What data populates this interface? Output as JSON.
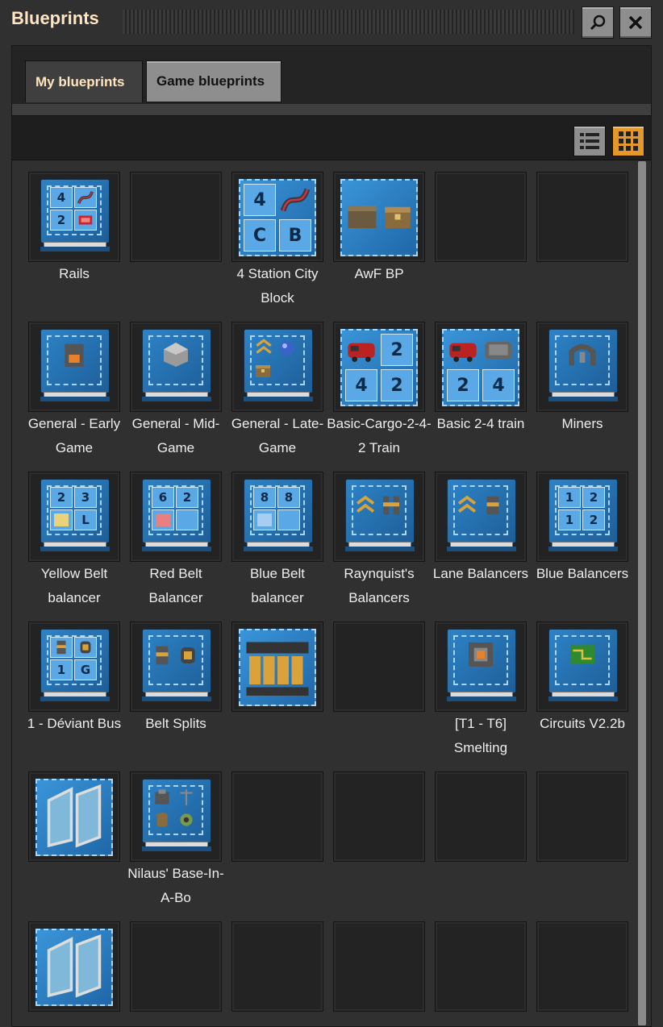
{
  "window": {
    "title": "Blueprints"
  },
  "title_buttons": {
    "search_icon": "magnifier-icon",
    "close_icon": "close-x-icon"
  },
  "tabs": [
    {
      "label": "My blueprints",
      "active": true
    },
    {
      "label": "Game blueprints",
      "active": false
    }
  ],
  "view_toggle": {
    "list_icon": "list-view-icon",
    "grid_icon": "grid-view-icon",
    "selected": "grid"
  },
  "colors": {
    "accent": "#e39827",
    "blueprint_blue": "#2d83c7",
    "label_text": "#eeeeee",
    "title_text": "#ffe6c0"
  },
  "slots": [
    {
      "kind": "book",
      "label": "Rails",
      "cells": [
        "4",
        "rail",
        "2",
        "signal"
      ]
    },
    {
      "kind": "empty",
      "label": ""
    },
    {
      "kind": "blueprint",
      "label": "4 Station City Block",
      "big": [
        "4",
        "rail",
        "C",
        "B"
      ]
    },
    {
      "kind": "blueprint",
      "label": "AwF BP",
      "icons": [
        "wall",
        "chest"
      ]
    },
    {
      "kind": "empty",
      "label": ""
    },
    {
      "kind": "empty",
      "label": ""
    },
    {
      "kind": "book",
      "label": "General - Early Game",
      "icons": [
        "furnace"
      ]
    },
    {
      "kind": "book",
      "label": "General - Mid-Game",
      "icons": [
        "steel"
      ]
    },
    {
      "kind": "book",
      "label": "General - Late-Game",
      "icons": [
        "belts",
        "sphere",
        "chest"
      ]
    },
    {
      "kind": "blueprint",
      "label": "Basic-Cargo-2-4-2 Train",
      "big": [
        "loco",
        "2",
        "4",
        "2"
      ]
    },
    {
      "kind": "blueprint",
      "label": "Basic 2-4 train",
      "big": [
        "loco",
        "wagon",
        "2",
        "4"
      ]
    },
    {
      "kind": "book",
      "label": "Miners",
      "icons": [
        "drill"
      ]
    },
    {
      "kind": "book",
      "label": "Yellow Belt balancer",
      "cells": [
        "2",
        "3",
        "yellow",
        "L"
      ]
    },
    {
      "kind": "book",
      "label": "Red Belt Balancer",
      "cells": [
        "6",
        "2",
        "red",
        ""
      ]
    },
    {
      "kind": "book",
      "label": "Blue Belt balancer",
      "cells": [
        "8",
        "8",
        "blue",
        ""
      ]
    },
    {
      "kind": "book",
      "label": "Raynquist's Balancers",
      "icons": [
        "belts",
        "splitters"
      ]
    },
    {
      "kind": "book",
      "label": "Lane Balancers",
      "icons": [
        "belts",
        "splitter"
      ]
    },
    {
      "kind": "book",
      "label": "Blue Balancers",
      "cells": [
        "1",
        "2",
        "1",
        "2"
      ]
    },
    {
      "kind": "book",
      "label": "1 - Déviant Bus",
      "cells": [
        "splitter",
        "underground",
        "1",
        "G"
      ]
    },
    {
      "kind": "book",
      "label": "Belt Splits",
      "icons": [
        "splitter",
        "underground"
      ]
    },
    {
      "kind": "blueprint",
      "label": "",
      "icons": [
        "smelter-row"
      ]
    },
    {
      "kind": "empty",
      "label": ""
    },
    {
      "kind": "book",
      "label": "[T1 - T6] Smelting",
      "icons": [
        "assembler"
      ]
    },
    {
      "kind": "book",
      "label": "Circuits V2.2b",
      "icons": [
        "circuit"
      ]
    },
    {
      "kind": "blueprint",
      "label": "",
      "icons": [
        "solar"
      ]
    },
    {
      "kind": "book",
      "label": "Nilaus' Base-In-A-Bo",
      "icons": [
        "rocket",
        "pole",
        "barrel",
        "gear"
      ]
    },
    {
      "kind": "empty",
      "label": ""
    },
    {
      "kind": "empty",
      "label": ""
    },
    {
      "kind": "empty",
      "label": ""
    },
    {
      "kind": "empty",
      "label": ""
    },
    {
      "kind": "blueprint",
      "label": "",
      "icons": [
        "solar"
      ]
    },
    {
      "kind": "empty",
      "label": ""
    },
    {
      "kind": "empty",
      "label": ""
    },
    {
      "kind": "empty",
      "label": ""
    },
    {
      "kind": "empty",
      "label": ""
    },
    {
      "kind": "empty",
      "label": ""
    }
  ]
}
